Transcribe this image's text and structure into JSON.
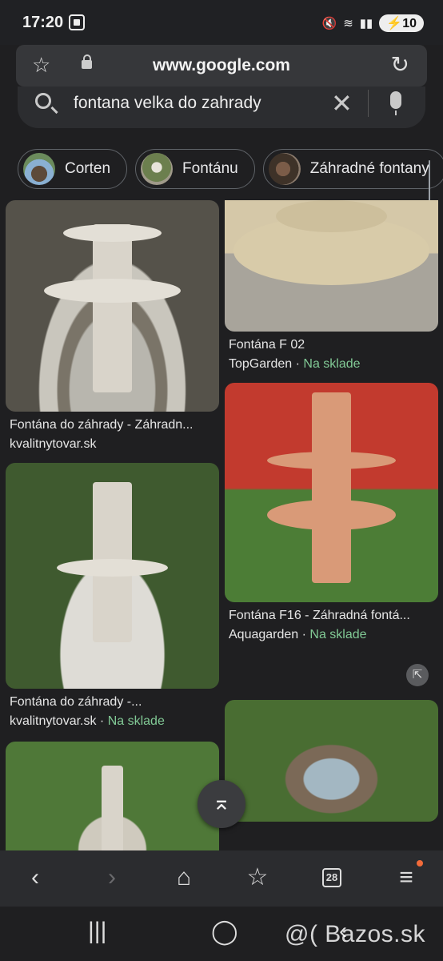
{
  "status_bar": {
    "time": "17:20",
    "battery": "10"
  },
  "url_bar": {
    "url": "www.google.com"
  },
  "search": {
    "query": "fontana velka do zahrady"
  },
  "chips": [
    {
      "label": "Corten"
    },
    {
      "label": "Fontánu"
    },
    {
      "label": "Záhradné fontany"
    }
  ],
  "results": [
    {
      "title": "Fontána do záhrady - Záhradn...",
      "source": "kvalitnytovar.sk",
      "stock": ""
    },
    {
      "title": "Fontána F 02",
      "source": "TopGarden",
      "stock": "Na sklade"
    },
    {
      "title": "Fontána F16 - Záhradná fontá...",
      "source": "Aquagarden",
      "stock": "Na sklade"
    },
    {
      "title": "Fontána do záhrady -...",
      "source": "kvalitnytovar.sk",
      "stock": "Na sklade"
    }
  ],
  "toolbar": {
    "tabs_count": "28"
  },
  "watermark": "@( Bazos.sk",
  "colors": {
    "background": "#1f1f21",
    "in_stock": "#81c995",
    "notification_dot": "#f26b3a"
  }
}
